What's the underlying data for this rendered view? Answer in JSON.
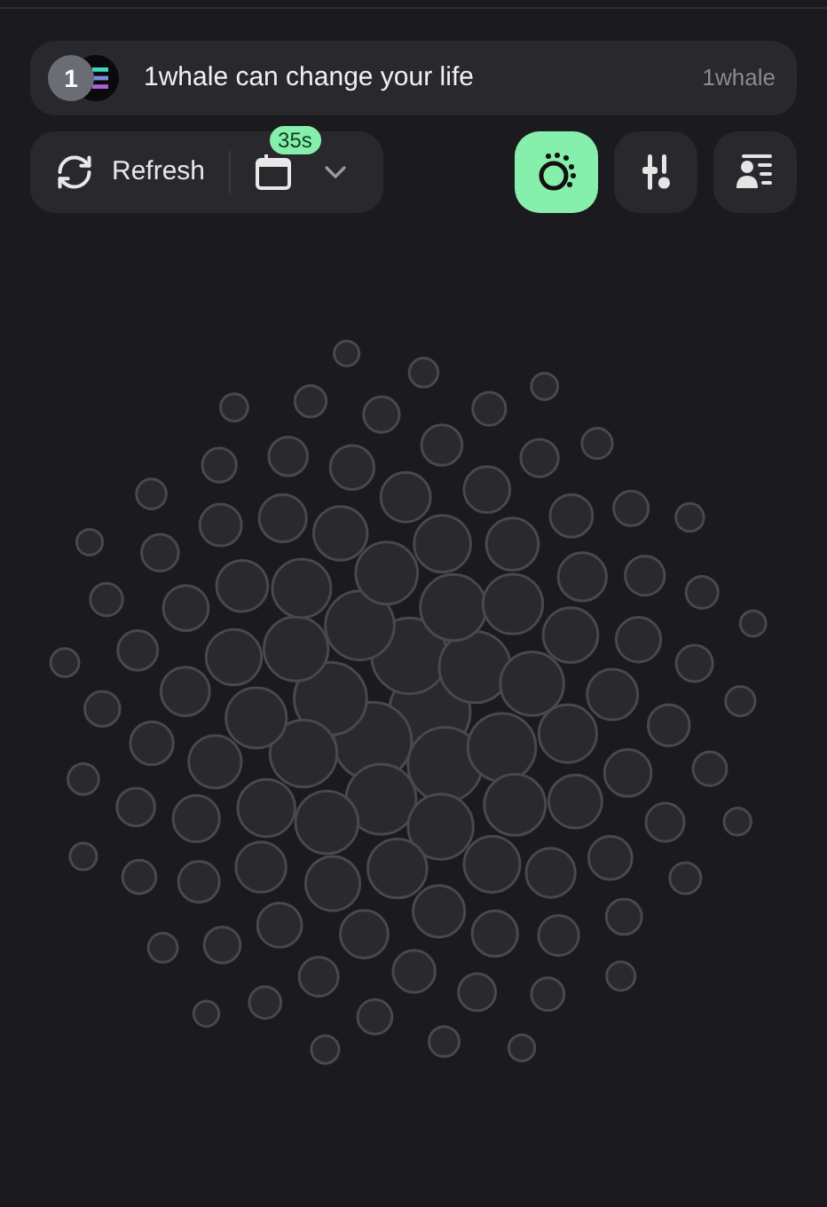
{
  "banner": {
    "avatar": "1",
    "message": "1whale can change your life",
    "source": "1whale"
  },
  "toolbar": {
    "refresh": "Refresh",
    "timer_badge": "35s"
  },
  "view_buttons": [
    {
      "kind": "bubbles",
      "selected": true
    },
    {
      "kind": "filters",
      "selected": false
    },
    {
      "kind": "list",
      "selected": false
    }
  ]
}
